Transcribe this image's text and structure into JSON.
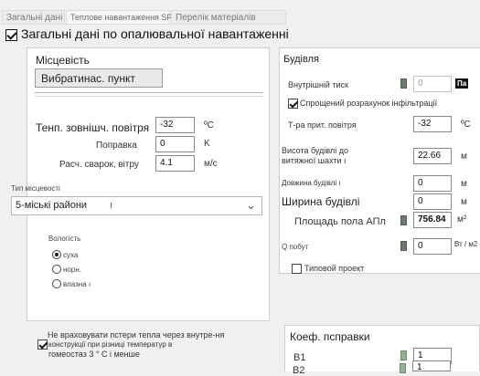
{
  "tabs": [
    "Загальні дані",
    "Теплове навантаження SP",
    "Перелік матеріалів"
  ],
  "section_title": "Загальні дані по опалювальної навантаженні",
  "location": {
    "header": "Місцевість",
    "place_button": "Вибратинас. пункт",
    "outside_temp_label": "Тенп. зовнішч. повітря",
    "outside_temp_value": "-32",
    "outside_temp_unit": "ºC",
    "correction_label": "Поправка",
    "correction_value": "0",
    "correction_unit": "K",
    "wind_label": "Расч. сварок, вітру",
    "wind_value": "4.1",
    "wind_unit": "м/с",
    "terrain_label": "Тип місцевості",
    "terrain_value": "5-міські райони",
    "terrain_suffix": "ı",
    "humidity_label": "Вологість",
    "humidity_options": [
      "суха",
      "норн.",
      "влазна ı"
    ],
    "humidity_selected": "суха"
  },
  "building": {
    "header": "Будівля",
    "internal_pressure_label": "Внутрішній тиск",
    "internal_pressure_value": "0",
    "internal_pressure_unit": "Па",
    "simplified_infiltration_label": "Спрощений розрахунок інфільтрації",
    "simplified_infiltration_checked": true,
    "supply_temp_label": "Т-ра прит. повітря",
    "supply_temp_value": "-32",
    "supply_temp_unit": "ºC",
    "height_label_line1": "Висота будівлі до",
    "height_label_line2": "витяжної шахти",
    "height_label_suffix": "ı",
    "height_value": "22.66",
    "height_unit": "м",
    "length_label": "Довжина будівлі ı",
    "length_value": "0",
    "length_unit": "м",
    "width_label": "Ширина будівлі",
    "width_value": "0",
    "width_unit": "м",
    "floor_area_label": "Площадь пола АПл",
    "floor_area_value": "756.84",
    "floor_area_unit": "м²",
    "q_label": "Q побут",
    "q_value": "0",
    "q_unit": "Вт / м2",
    "typical_project_label": "Типовой проект",
    "typical_project_checked": false
  },
  "ignore_loss": {
    "label_line1": "Не враховувати пстери тепла через внутре-ня",
    "label_line2": "конструкції при різниці температур в",
    "label_line3": "гомеостаз 3 ° С і менше",
    "checked": true
  },
  "correction_coef": {
    "header": "Коеф. псправки",
    "b1_label": "В1",
    "b1_value": "1",
    "b2_label": "В2",
    "b2_value": "1"
  }
}
